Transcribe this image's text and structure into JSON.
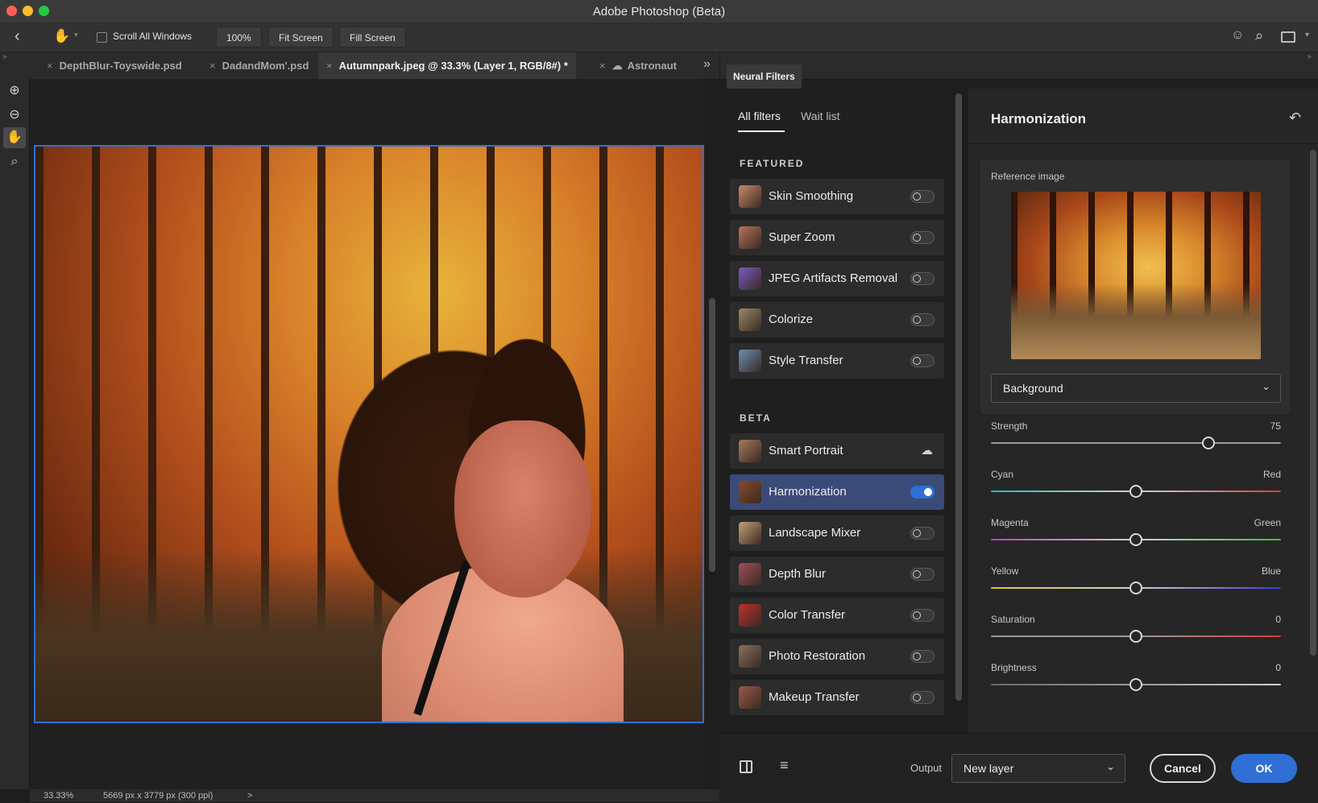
{
  "app": {
    "title": "Adobe Photoshop (Beta)"
  },
  "options_bar": {
    "scroll_all_windows": "Scroll All Windows",
    "zoom_level": "100%",
    "fit_screen": "Fit Screen",
    "fill_screen": "Fill Screen"
  },
  "tabs": [
    {
      "label": "DepthBlur-Toyswide.psd"
    },
    {
      "label": "DadandMom'.psd"
    },
    {
      "label": "Autumnpark.jpeg @ 33.3% (Layer 1, RGB/8#) *"
    },
    {
      "label": "Astronaut"
    }
  ],
  "status": {
    "zoom": "33.33%",
    "doc_info": "5669 px x 3779 px (300 ppi)",
    "more": ">"
  },
  "neural_filters": {
    "panel_title": "Neural Filters",
    "subtabs": {
      "all": "All filters",
      "wait": "Wait list"
    },
    "featured_label": "FEATURED",
    "beta_label": "BETA",
    "featured": [
      {
        "name": "Skin Smoothing",
        "on": false
      },
      {
        "name": "Super Zoom",
        "on": false
      },
      {
        "name": "JPEG Artifacts Removal",
        "on": false
      },
      {
        "name": "Colorize",
        "on": false
      },
      {
        "name": "Style Transfer",
        "on": false
      }
    ],
    "beta": [
      {
        "name": "Smart Portrait",
        "state": "download"
      },
      {
        "name": "Harmonization",
        "on": true
      },
      {
        "name": "Landscape Mixer",
        "on": false
      },
      {
        "name": "Depth Blur",
        "on": false
      },
      {
        "name": "Color Transfer",
        "on": false
      },
      {
        "name": "Photo Restoration",
        "on": false
      },
      {
        "name": "Makeup Transfer",
        "on": false
      }
    ]
  },
  "harmonization": {
    "title": "Harmonization",
    "reference_label": "Reference image",
    "reference_layer": "Background",
    "sliders": [
      {
        "label": "Strength",
        "right": "75",
        "value": 75
      },
      {
        "label": "Cyan",
        "right": "Red",
        "value": 50
      },
      {
        "label": "Magenta",
        "right": "Green",
        "value": 50
      },
      {
        "label": "Yellow",
        "right": "Blue",
        "value": 50
      },
      {
        "label": "Saturation",
        "right": "0",
        "value": 50
      },
      {
        "label": "Brightness",
        "right": "0",
        "value": 50
      }
    ]
  },
  "footer": {
    "output_label": "Output",
    "output_value": "New layer",
    "cancel": "Cancel",
    "ok": "OK"
  }
}
